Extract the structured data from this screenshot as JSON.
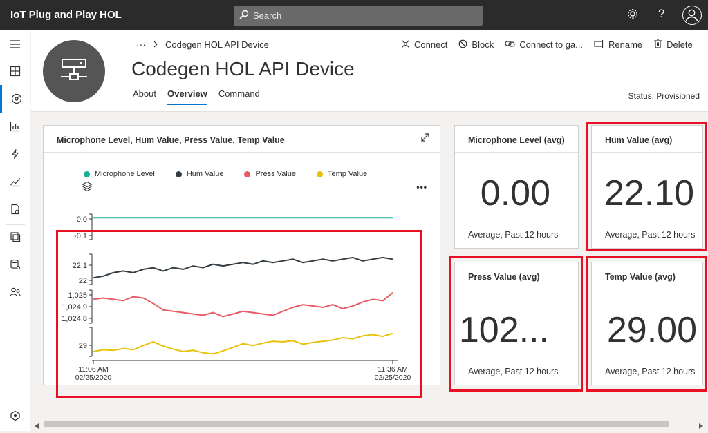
{
  "app": {
    "title": "IoT Plug and Play HOL"
  },
  "search": {
    "placeholder": "Search"
  },
  "topbar_icons": [
    "gear-icon",
    "help-icon",
    "user-avatar"
  ],
  "help_glyph": "?",
  "breadcrumb": {
    "ellipsis": "···",
    "current": "Codegen HOL API Device"
  },
  "device": {
    "title": "Codegen HOL API Device",
    "status": "Status: Provisioned"
  },
  "tabs": [
    "About",
    "Overview",
    "Command"
  ],
  "active_tab": "Overview",
  "actions": {
    "connect": "Connect",
    "block": "Block",
    "gateway": "Connect to ga...",
    "rename": "Rename",
    "delete": "Delete"
  },
  "main_chart": {
    "title": "Microphone Level, Hum Value, Press Value, Temp Value",
    "more_glyph": "•••"
  },
  "kpis": {
    "mic": {
      "title": "Microphone Level (avg)",
      "value": "0.00",
      "foot": "Average, Past 12 hours"
    },
    "hum": {
      "title": "Hum Value (avg)",
      "value": "22.10",
      "foot": "Average, Past 12 hours"
    },
    "press": {
      "title": "Press Value (avg)",
      "value": "102...",
      "foot": "Average, Past 12 hours"
    },
    "temp": {
      "title": "Temp Value (avg)",
      "value": "29.00",
      "foot": "Average, Past 12 hours"
    }
  },
  "colors": {
    "mic": "#1aaf99",
    "hum": "#333c42",
    "press": "#ea5a65",
    "temp": "#e8c10b",
    "accent": "#0078d4",
    "highlight": "#e81123"
  },
  "chart_data": {
    "type": "line",
    "title": "Microphone Level, Hum Value, Press Value, Temp Value",
    "x_ticks": [
      {
        "time": "11:06 AM",
        "date": "02/25/2020"
      },
      {
        "time": "11:36 AM",
        "date": "02/25/2020"
      }
    ],
    "x": [
      0,
      1,
      2,
      3,
      4,
      5,
      6,
      7,
      8,
      9,
      10,
      11,
      12,
      13,
      14,
      15,
      16,
      17,
      18,
      19,
      20,
      21,
      22,
      23,
      24,
      25,
      26,
      27,
      28,
      29,
      30
    ],
    "legend_position": "top",
    "series": [
      {
        "name": "Microphone Level",
        "ticks": [
          "0.0",
          "-0.1"
        ],
        "ylim": [
          -0.12,
          0.02
        ],
        "values": [
          0,
          0,
          0,
          0,
          0,
          0,
          0,
          0,
          0,
          0,
          0,
          0,
          0,
          0,
          0,
          0,
          0,
          0,
          0,
          0,
          0,
          0,
          0,
          0,
          0,
          0,
          0,
          0,
          0,
          0,
          0
        ]
      },
      {
        "name": "Hum Value",
        "ticks": [
          "22.1",
          "22"
        ],
        "ylim": [
          21.98,
          22.16
        ],
        "values": [
          22.02,
          22.03,
          22.05,
          22.06,
          22.05,
          22.07,
          22.08,
          22.06,
          22.08,
          22.07,
          22.09,
          22.08,
          22.1,
          22.09,
          22.1,
          22.11,
          22.1,
          22.12,
          22.11,
          22.12,
          22.13,
          22.11,
          22.12,
          22.13,
          22.12,
          22.13,
          22.14,
          22.12,
          22.13,
          22.14,
          22.13
        ]
      },
      {
        "name": "Press Value",
        "ticks": [
          "1,025",
          "1,024.9",
          "1,024.8"
        ],
        "ylim": [
          1024.78,
          1025.03
        ],
        "values": [
          1024.96,
          1024.97,
          1024.96,
          1024.95,
          1024.98,
          1024.97,
          1024.93,
          1024.88,
          1024.87,
          1024.86,
          1024.85,
          1024.84,
          1024.86,
          1024.83,
          1024.85,
          1024.87,
          1024.86,
          1024.85,
          1024.84,
          1024.87,
          1024.9,
          1024.92,
          1024.91,
          1024.9,
          1024.92,
          1024.89,
          1024.91,
          1024.94,
          1024.96,
          1024.95,
          1025.01
        ]
      },
      {
        "name": "Temp Value",
        "ticks": [
          "29"
        ],
        "ylim": [
          28.82,
          29.3
        ],
        "values": [
          28.9,
          28.93,
          28.92,
          28.95,
          28.93,
          29.0,
          29.06,
          28.99,
          28.94,
          28.9,
          28.92,
          28.88,
          28.86,
          28.91,
          28.97,
          29.03,
          29.0,
          29.04,
          29.07,
          29.06,
          29.08,
          29.02,
          29.05,
          29.07,
          29.09,
          29.13,
          29.11,
          29.16,
          29.18,
          29.15,
          29.2
        ]
      }
    ]
  }
}
